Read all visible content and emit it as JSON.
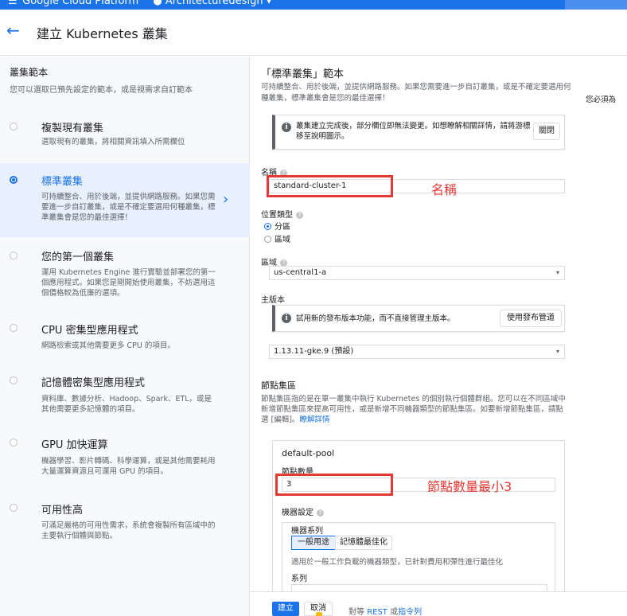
{
  "topbar": {
    "product_name": "Google Cloud Platform",
    "project_name": "Architecturedesign"
  },
  "header": {
    "back_icon": "arrow-left-icon",
    "title": "建立 Kubernetes 叢集"
  },
  "left_panel": {
    "title": "叢集範本",
    "subtitle": "您可以選取已預先設定的範本，或是視需求自訂範本",
    "templates": [
      {
        "title": "複製現有叢集",
        "desc": "選取現有的叢集，將相關資訊填入所需欄位"
      },
      {
        "title": "標準叢集",
        "desc": "可持續整合、用於後端，並提供網路服務。如果您需要進一步自訂叢集，或是不確定要選用何種叢集，標準叢集會是您的最佳選擇！"
      },
      {
        "title": "您的第一個叢集",
        "desc": "運用 Kubernetes Engine 進行實驗並部署您的第一個應用程式。如果您是剛開始使用叢集，不妨選用這個價格較為低廉的選項。"
      },
      {
        "title": "CPU 密集型應用程式",
        "desc": "網路檢索或其他需要更多 CPU 的項目。"
      },
      {
        "title": "記憶體密集型應用程式",
        "desc": "資料庫、數據分析、Hadoop、Spark、ETL，或是其他需要更多記憶體的項目。"
      },
      {
        "title": "GPU 加快運算",
        "desc": "機器學習、影片轉碼、科學運算，或是其他需要耗用大量運算資源且可運用 GPU 的項目。"
      },
      {
        "title": "可用性高",
        "desc": "可滿足嚴格的可用性需求，系統會複製所有區域中的主要執行個體與節點。"
      }
    ],
    "selected_index": 1
  },
  "form": {
    "title": "「標準叢集」範本",
    "desc": "可持續整合、用於後端，並提供網路服務。如果您需要進一步自訂叢集，或是不確定要選用何種叢集，標準叢集會是您的最佳選擇！",
    "outside_text": "您必須為",
    "notice": {
      "text": "叢集建立完成後，部分欄位即無法變更。如想瞭解相關詳情，請將游標移至說明圖示。",
      "close_label": "關閉"
    },
    "name": {
      "label": "名稱",
      "value": "standard-cluster-1"
    },
    "location_type": {
      "label": "位置類型",
      "options": [
        "分區",
        "區域"
      ],
      "selected": "分區"
    },
    "zone": {
      "label": "區域",
      "value": "us-central1-a"
    },
    "master_version": {
      "label": "主版本",
      "notice_text": "試用新的發布版本功能，而不直接管理主版本。",
      "channel_button": "使用發布管道",
      "value": "1.13.11-gke.9 (預設)"
    },
    "node_pools": {
      "title": "節點集區",
      "desc": "節點集區指的是在單一叢集中執行 Kubernetes 的個別執行個體群組。您可以在不同區域中新增節點集區來提高可用性，或是新增不同機器類型的節點集區。如要新增節點集區，請點選 [編輯]。",
      "link": "瞭解詳情"
    },
    "pool": {
      "name": "default-pool",
      "node_count_label": "節點數量",
      "node_count": "3",
      "machine_config_label": "機器設定",
      "machine_family_label": "機器系列",
      "families": [
        "一般用途",
        "記憶體最佳化"
      ],
      "selected_family": "一般用途",
      "family_desc": "適用於一般工作負載的機器類型，已針對費用和彈性進行最佳化",
      "series_label": "系列"
    }
  },
  "annotations": {
    "name_note": "名稱",
    "node_note": "節點數量最小3",
    "color": "#e53935"
  },
  "footer": {
    "create_label": "建立",
    "cancel_label": "取消",
    "equiv_text": "對等",
    "rest_link": "REST",
    "or_text": "或",
    "cmd_link": "指令列"
  },
  "colors": {
    "accent": "#1a73e8",
    "selected_bg": "#e8f0fe",
    "annotation": "#e53935"
  }
}
